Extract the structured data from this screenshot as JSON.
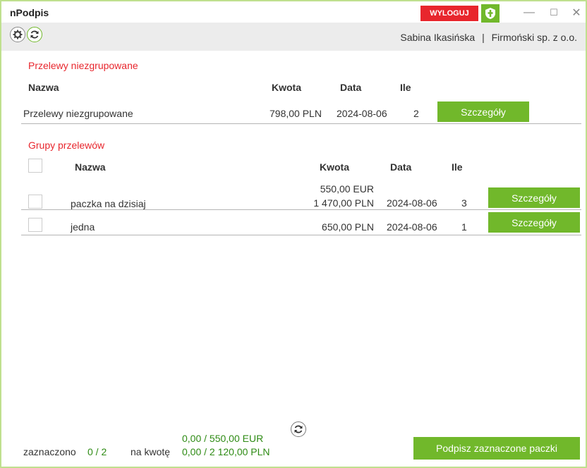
{
  "window": {
    "title": "nPodpis",
    "logout_label": "WYLOGUJ",
    "minimize": "—",
    "maximize": "☐",
    "close": "✕"
  },
  "toolbar": {
    "user": "Sabina Ikasińska",
    "separator": "|",
    "company": "Firmoński sp. z o.o."
  },
  "ungrouped": {
    "section_title": "Przelewy niezgrupowane",
    "headers": {
      "name": "Nazwa",
      "amount": "Kwota",
      "date": "Data",
      "count": "Ile"
    },
    "row": {
      "name": "Przelewy niezgrupowane",
      "amount": "798,00 PLN",
      "date": "2024-08-06",
      "count": "2",
      "details_label": "Szczegóły"
    }
  },
  "groups": {
    "section_title": "Grupy przelewów",
    "headers": {
      "name": "Nazwa",
      "amount": "Kwota",
      "date": "Data",
      "count": "Ile"
    },
    "rows": [
      {
        "name": "paczka na dzisiaj",
        "amount_1": "550,00 EUR",
        "amount_2": "1 470,00 PLN",
        "date": "2024-08-06",
        "count": "3",
        "details_label": "Szczegóły"
      },
      {
        "name": "jedna",
        "amount_1": "650,00 PLN",
        "date": "2024-08-06",
        "count": "1",
        "details_label": "Szczegóły"
      }
    ]
  },
  "footer": {
    "selected_label": "zaznaczono",
    "selected_value": "0 / 2",
    "amount_label": "na kwotę",
    "amount_eur": "0,00 / 550,00 EUR",
    "amount_pln": "0,00 / 2 120,00 PLN",
    "sign_label": "Podpisz zaznaczone paczki"
  },
  "colors": {
    "accent_green": "#71b82b",
    "accent_red": "#e8262d",
    "text_green": "#2e8b14"
  }
}
